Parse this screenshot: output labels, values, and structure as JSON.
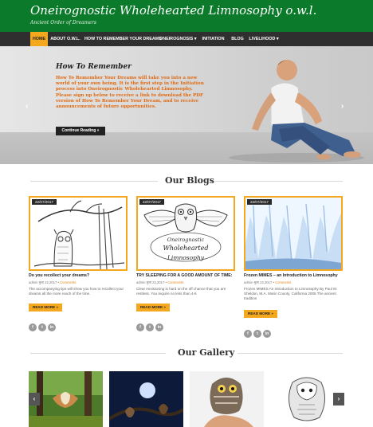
{
  "site": {
    "title": "Oneirognostic Wholehearted Limnosophy o.w.l.",
    "tagline": "Ancient Order of Dreamers"
  },
  "nav": {
    "items": [
      {
        "label": "HOME",
        "active": true
      },
      {
        "label": "ABOUT O.W.L.",
        "active": false
      },
      {
        "label": "HOW TO REMEMBER YOUR DREAMS",
        "active": false
      },
      {
        "label": "ONEIROGNOSIS ▾",
        "active": false
      },
      {
        "label": "INITIATION",
        "active": false
      },
      {
        "label": "BLOG",
        "active": false
      },
      {
        "label": "LIVELIHOOD ▾",
        "active": false
      }
    ]
  },
  "hero": {
    "title": "How To Remember",
    "text": "How To Remember Your Dreams will take you into a new world of your own being.  It is the first step in the Initiation process into Oneirognostic Wholehearted Limnosophy. Please sign up below to receive a link to download the PDF version of How To Remember Your Dream, and to receive announcements of future opportunities.",
    "button_label": "Continue Reading »",
    "prev_arrow": "‹",
    "next_arrow": "›"
  },
  "blogs": {
    "heading": "Our Blogs",
    "posts": [
      {
        "date": "22/07/2017",
        "title": "Do you recollect your dreams?",
        "author_date": "admin मुला 22,2017 •",
        "comments": "Comments",
        "excerpt": "The accompanying tips will show you how to recollect your dreams all the more reach of the time.",
        "read_more": "READ MORE »"
      },
      {
        "date": "22/07/2017",
        "title": "TRY SLEEPING FOR A GOOD AMOUNT OF TIME:",
        "author_date": "admin मुला 22,2017 •",
        "comments": "Comments",
        "excerpt": "Clear envisioning is hard on the off chance that you are restless. You require no less than 4-6",
        "read_more": "READ MORE »",
        "image_caption": [
          "Oneirognostic",
          "Wholehearted",
          "Limnosophy"
        ]
      },
      {
        "date": "22/07/2017",
        "title": "Frozen MIMES – an Introduction to Limnosophy",
        "author_date": "admin मुला 22,2017 •",
        "comments": "Comments",
        "excerpt": "Frozen MIMES An Introduction to Limnosophy By Paul M. Sheldon, M.A. Marin County, California 2005 The ancient tradition",
        "read_more": "READ MORE »"
      }
    ],
    "social_icons": [
      "f",
      "t",
      "in"
    ]
  },
  "gallery": {
    "heading": "Our Gallery",
    "prev_arrow": "‹",
    "next_arrow": "›"
  },
  "colors": {
    "header_green": "#0b7a2a",
    "accent_orange": "#f4a81d",
    "nav_dark": "#2f2f2f",
    "hero_text_orange": "#e06a12"
  }
}
